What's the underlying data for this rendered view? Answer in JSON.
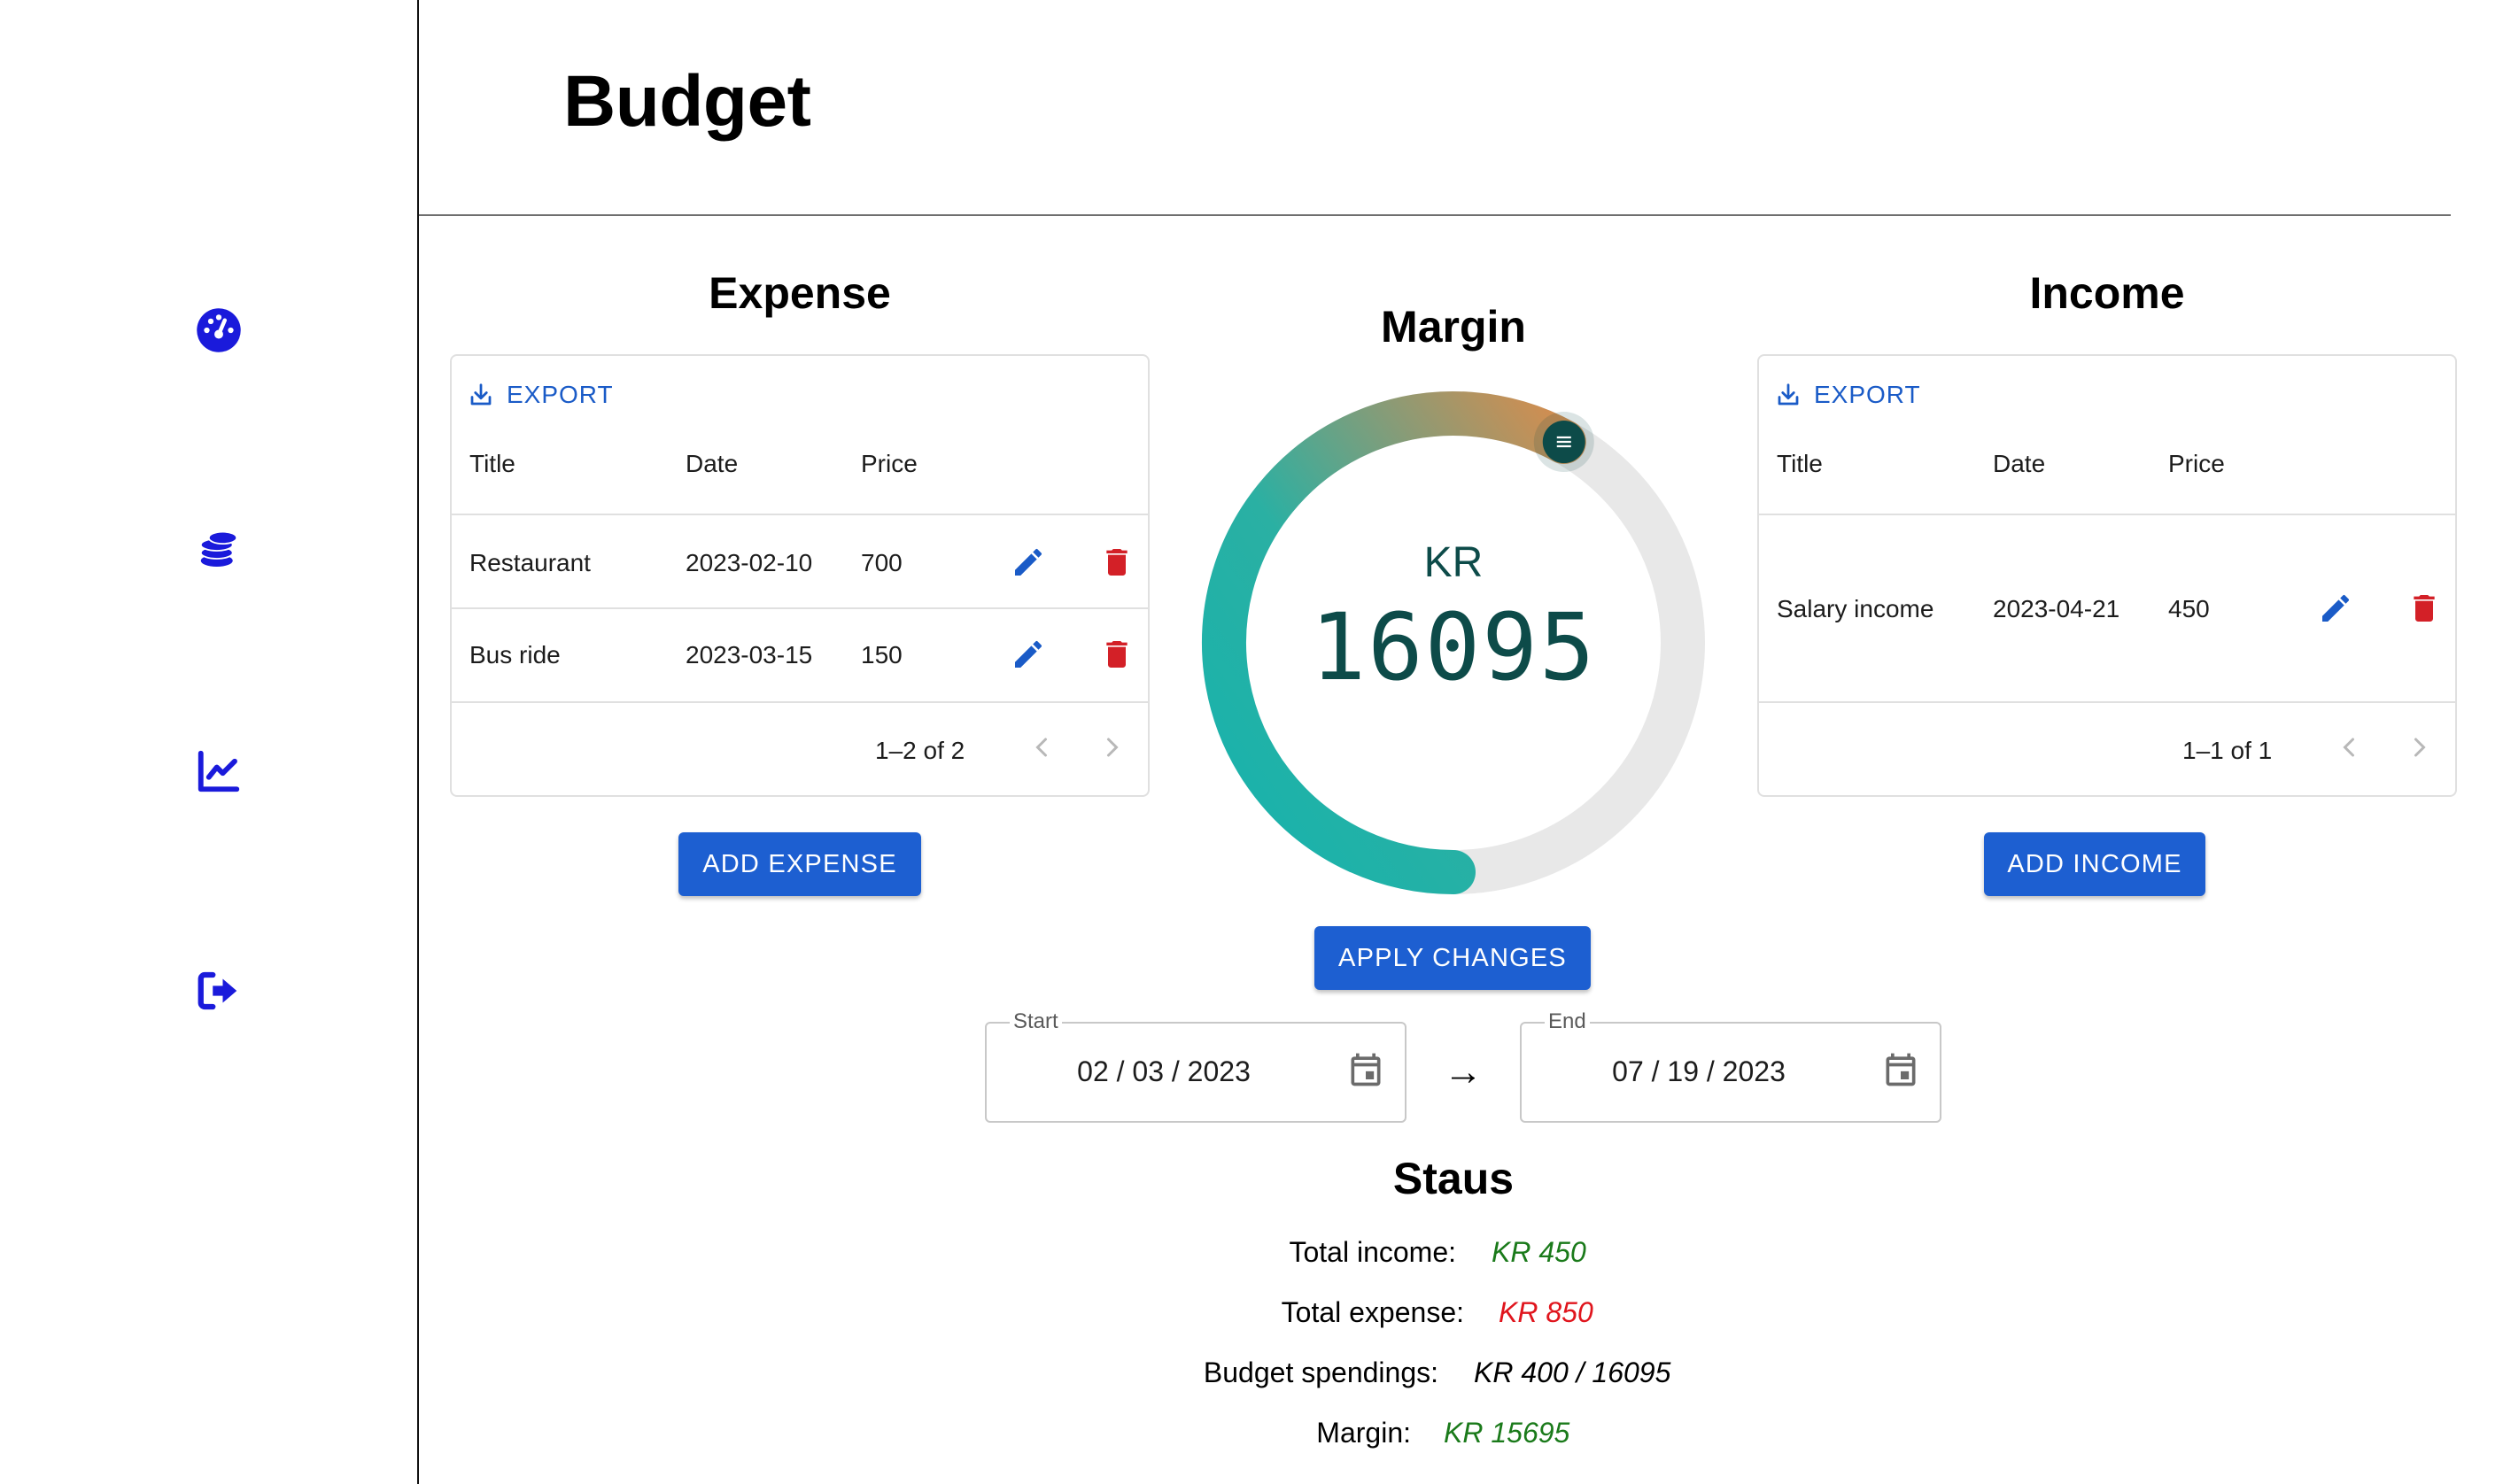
{
  "colors": {
    "primary": "#1d5fd1",
    "sidebar_icon": "#1a1adb",
    "delete": "#d32027",
    "gauge_teal": "#16b3ad",
    "gauge_orange": "#d48d4f",
    "gauge_text": "#0d4b49",
    "income_green": "#1a7a1a",
    "expense_red": "#e0151d"
  },
  "sidebar": {
    "items": [
      {
        "icon": "dashboard-icon"
      },
      {
        "icon": "coins-icon"
      },
      {
        "icon": "line-chart-icon"
      },
      {
        "icon": "logout-icon"
      }
    ]
  },
  "header": {
    "title": "Budget"
  },
  "expense": {
    "title": "Expense",
    "export_label": "EXPORT",
    "columns": [
      "Title",
      "Date",
      "Price"
    ],
    "rows": [
      {
        "title": "Restaurant",
        "date": "2023-02-10",
        "price": "700"
      },
      {
        "title": "Bus ride",
        "date": "2023-03-15",
        "price": "150"
      }
    ],
    "pagination": "1–2 of 2",
    "add_button": "ADD EXPENSE"
  },
  "margin": {
    "title": "Margin",
    "currency": "KR",
    "value": "16095",
    "fill_fraction": 0.58,
    "apply_button": "APPLY CHANGES"
  },
  "income": {
    "title": "Income",
    "export_label": "EXPORT",
    "columns": [
      "Title",
      "Date",
      "Price"
    ],
    "rows": [
      {
        "title": "Salary income",
        "date": "2023-04-21",
        "price": "450"
      }
    ],
    "pagination": "1–1 of 1",
    "add_button": "ADD INCOME"
  },
  "date_range": {
    "start_label": "Start",
    "start_value": "02 / 03 / 2023",
    "arrow": "→",
    "end_label": "End",
    "end_value": "07 / 19 / 2023"
  },
  "status": {
    "title": "Staus",
    "total_income_label": "Total income:",
    "total_income_value": "KR 450",
    "total_expense_label": "Total expense:",
    "total_expense_value": "KR 850",
    "budget_label": "Budget spendings:",
    "budget_value": "KR 400 / 16095",
    "margin_label": "Margin:",
    "margin_value": "KR 15695"
  }
}
